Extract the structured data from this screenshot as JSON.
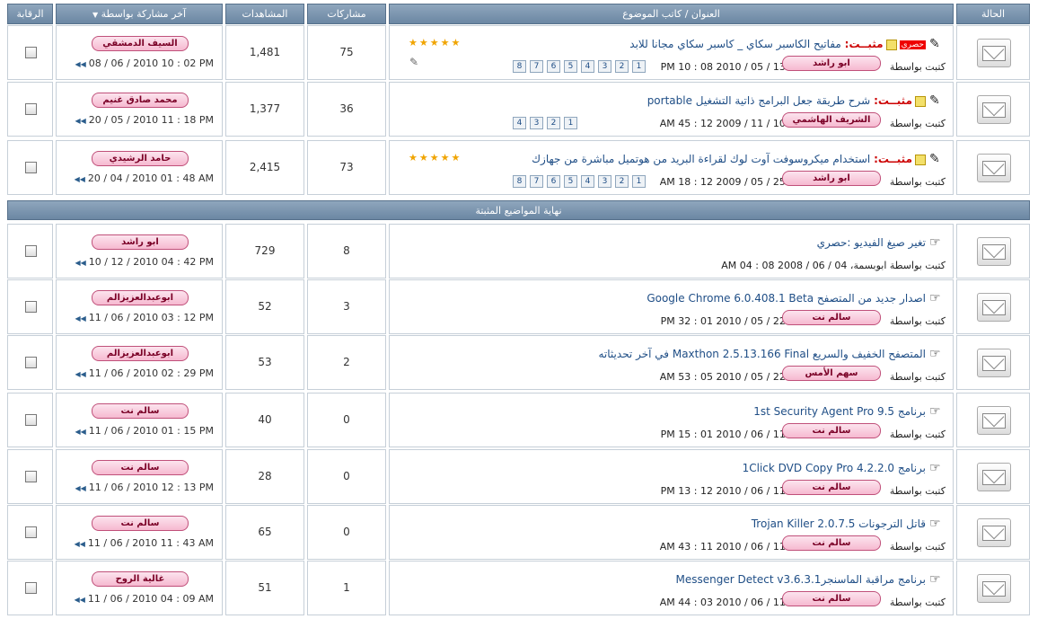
{
  "header": {
    "status": "الحالة",
    "title": "العنوان / كاتب الموضوع",
    "replies": "مشاركات",
    "views": "المشاهدات",
    "last": "آخر مشاركة بواسطة",
    "watch": "الرقابة",
    "sort_icon": "▼"
  },
  "separator": "نهاية المواضيع المثبتة",
  "by_label": "كتبت بواسطة",
  "sticky_label": "مثبــت:",
  "hot_label": "حصري",
  "rows": [
    {
      "sticky": true,
      "hot": true,
      "title": "مفاتيح الكاسبر سكاي _ كاسبر سكاي مجانا للابد",
      "author": "ابو راشد",
      "date": "13 / 05 / 2010 08 : 10 PM",
      "pages": [
        "1",
        "2",
        "3",
        "4",
        "5",
        "6",
        "7",
        "8"
      ],
      "stars": "★★★★★",
      "replies": "75",
      "views": "1,481",
      "last_user": "السيف الدمشقي",
      "last_date": "08 / 06 / 2010 10 : 02 PM"
    },
    {
      "sticky": true,
      "hot": false,
      "title": "شرح طريقة جعل البرامج ذاتية التشغيل portable",
      "author": "الشريف الهاشمي",
      "date": "10 / 11 / 2009 12 : 45 AM",
      "pages": [
        "1",
        "2",
        "3",
        "4"
      ],
      "stars": "",
      "replies": "36",
      "views": "1,377",
      "last_user": "محمد صادق غنيم",
      "last_date": "20 / 05 / 2010 11 : 18 PM"
    },
    {
      "sticky": true,
      "hot": false,
      "title": "استخدام ميكروسوفت آوت لوك لقراءة البريد من هوتميل مباشرة من جهازك",
      "author": "ابو راشد",
      "date": "25 / 05 / 2009 12 : 18 AM",
      "pages": [
        "1",
        "2",
        "3",
        "4",
        "5",
        "6",
        "7",
        "8"
      ],
      "stars": "★★★★★",
      "replies": "73",
      "views": "2,415",
      "last_user": "حامد الرشيدي",
      "last_date": "20 / 04 / 2010 01 : 48 AM"
    },
    {
      "sticky": false,
      "title": "تغير صيغ الفيديو :حصري",
      "author_inline": "ابوبسمة، 04 / 06 / 2008 08 : 04 AM",
      "replies": "8",
      "views": "729",
      "last_user": "ابو راشد",
      "last_date": "10 / 12 / 2010 04 : 42 PM"
    },
    {
      "sticky": false,
      "title": "اصدار جديد من المتصفح Google Chrome 6.0.408.1 Beta",
      "author": "سالم نت",
      "date": "22 / 05 / 2010 01 : 32 PM",
      "replies": "3",
      "views": "52",
      "last_user": "ابوعبدالعزيزالم",
      "last_date": "11 / 06 / 2010 03 : 12 PM"
    },
    {
      "sticky": false,
      "title": "المتصفح الخفيف والسريع Maxthon 2.5.13.166 Final في آخر تحديثاته",
      "author": "سهم الأمس",
      "date": "22 / 05 / 2010 05 : 53 AM",
      "replies": "2",
      "views": "53",
      "last_user": "ابوعبدالعزيزالم",
      "last_date": "11 / 06 / 2010 02 : 29 PM"
    },
    {
      "sticky": false,
      "title": "برنامج 1st Security Agent Pro 9.5",
      "author": "سالم نت",
      "date": "11 / 06 / 2010 01 : 15 PM",
      "replies": "0",
      "views": "40",
      "last_user": "سالم نت",
      "last_date": "11 / 06 / 2010 01 : 15 PM"
    },
    {
      "sticky": false,
      "title": "برنامج 1Click DVD Copy Pro 4.2.2.0",
      "author": "سالم نت",
      "date": "11 / 06 / 2010 12 : 13 PM",
      "replies": "0",
      "views": "28",
      "last_user": "سالم نت",
      "last_date": "11 / 06 / 2010 12 : 13 PM"
    },
    {
      "sticky": false,
      "title": "قاتل الترجونات Trojan Killer 2.0.7.5",
      "author": "سالم نت",
      "date": "11 / 06 / 2010 11 : 43 AM",
      "replies": "0",
      "views": "65",
      "last_user": "سالم نت",
      "last_date": "11 / 06 / 2010 11 : 43 AM"
    },
    {
      "sticky": false,
      "title": "برنامج مراقبة الماسنجرMessenger Detect v3.6.3.1",
      "author": "سالم نت",
      "date": "11 / 06 / 2010 03 : 44 AM",
      "replies": "1",
      "views": "51",
      "last_user": "غالية الروح",
      "last_date": "11 / 06 / 2010 04 : 09 AM"
    }
  ],
  "colors": {
    "header": "#6b87a3",
    "link": "#1f4e86",
    "sticky": "#cc0000",
    "pill": "#f6b9d0"
  },
  "icons": {
    "status": "envelope-icon",
    "last_post": "go-to-last-post-icon",
    "attachment": "paperclip-icon",
    "rating": "star-icon",
    "topic": "topic-icon"
  }
}
